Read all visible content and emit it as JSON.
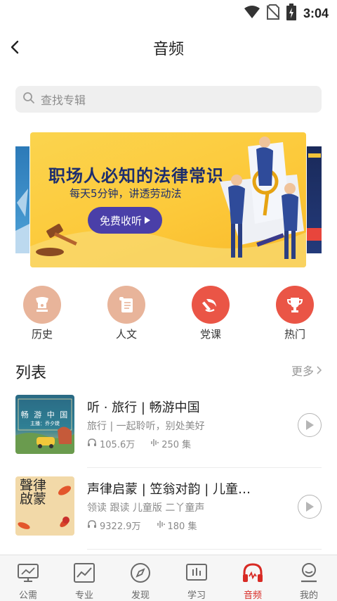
{
  "status_bar": {
    "time": "3:04",
    "icons": [
      "wifi-icon",
      "no-sim-icon",
      "battery-charging-icon"
    ]
  },
  "header": {
    "title": "音频",
    "back_icon": "chevron-left-icon"
  },
  "search": {
    "placeholder": "查找专辑",
    "icon": "search-icon"
  },
  "banner": {
    "title": "职场人必知的法律常识",
    "subtitle": "每天5分钟，讲透劳动法",
    "button_label": "免费收听"
  },
  "categories": [
    {
      "label": "历史",
      "icon": "history-icon",
      "color": "#e9b59b"
    },
    {
      "label": "人文",
      "icon": "scroll-icon",
      "color": "#e9b59b"
    },
    {
      "label": "党课",
      "icon": "hammer-sickle-icon",
      "color": "#ec5a4b"
    },
    {
      "label": "热门",
      "icon": "trophy-icon",
      "color": "#ec5a4b"
    }
  ],
  "list": {
    "title": "列表",
    "more_label": "更多",
    "albums": [
      {
        "title": "听 · 旅行 | 畅游中国",
        "description": "旅行 | 一起聆听，别处美好",
        "plays": "105.6万",
        "episodes": "250 集",
        "cover": {
          "title": "畅 游 中 国",
          "author": "主播：乔夕婕"
        }
      },
      {
        "title": "声律启蒙 | 笠翁对韵 | 儿童…",
        "description": "领读 跟读 儿童版 二丫童声",
        "plays": "9322.9万",
        "episodes": "180 集",
        "cover": {
          "title": "聲律啟蒙"
        }
      }
    ]
  },
  "bottom_nav": [
    {
      "label": "公需",
      "icon": "monitor-icon",
      "active": false
    },
    {
      "label": "专业",
      "icon": "chart-icon",
      "active": false
    },
    {
      "label": "发现",
      "icon": "compass-icon",
      "active": false
    },
    {
      "label": "学习",
      "icon": "study-icon",
      "active": false
    },
    {
      "label": "音频",
      "icon": "headphones-icon",
      "active": true
    },
    {
      "label": "我的",
      "icon": "profile-icon",
      "active": false
    }
  ],
  "colors": {
    "accent": "#d82a24",
    "banner_bg": "#fcc93a",
    "banner_text": "#1d2e6e",
    "banner_button": "#4a3fa8"
  }
}
